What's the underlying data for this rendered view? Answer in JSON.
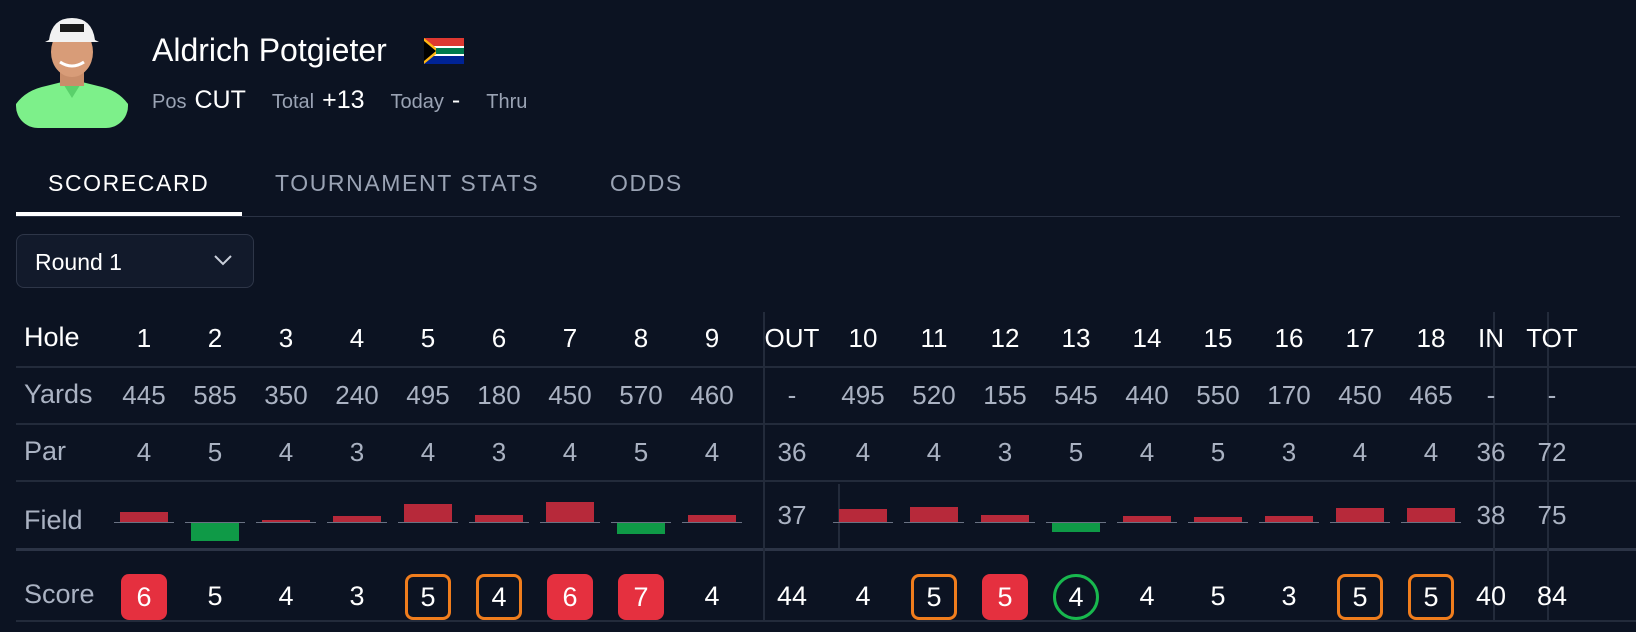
{
  "player": {
    "name": "Aldrich Potgieter",
    "flag": "south-africa-flag",
    "pos_label": "Pos",
    "pos": "CUT",
    "total_label": "Total",
    "total": "+13",
    "today_label": "Today",
    "today": "-",
    "thru_label": "Thru",
    "thru": ""
  },
  "tabs": [
    {
      "label": "SCORECARD",
      "active": true
    },
    {
      "label": "TOURNAMENT STATS",
      "active": false
    },
    {
      "label": "ODDS",
      "active": false
    }
  ],
  "round_select": {
    "value": "Round 1",
    "icon": "chevron-down-icon"
  },
  "scorecard": {
    "row_labels": {
      "hole": "Hole",
      "yards": "Yards",
      "par": "Par",
      "field": "Field",
      "score": "Score"
    },
    "columns": [
      "1",
      "2",
      "3",
      "4",
      "5",
      "6",
      "7",
      "8",
      "9",
      "OUT",
      "10",
      "11",
      "12",
      "13",
      "14",
      "15",
      "16",
      "17",
      "18",
      "IN",
      "TOT"
    ],
    "yards": [
      "445",
      "585",
      "350",
      "240",
      "495",
      "180",
      "450",
      "570",
      "460",
      "-",
      "495",
      "520",
      "155",
      "545",
      "440",
      "550",
      "170",
      "450",
      "465",
      "-",
      "-"
    ],
    "par": [
      "4",
      "5",
      "4",
      "3",
      "4",
      "3",
      "4",
      "5",
      "4",
      "36",
      "4",
      "4",
      "3",
      "5",
      "4",
      "5",
      "3",
      "4",
      "4",
      "36",
      "72"
    ],
    "field_totals": {
      "out": "37",
      "in": "38",
      "tot": "75"
    },
    "field_vs_par": [
      0.12,
      -0.22,
      0.03,
      0.08,
      0.22,
      0.09,
      0.25,
      -0.14,
      0.09,
      null,
      0.16,
      0.19,
      0.09,
      -0.11,
      0.08,
      0.06,
      0.08,
      0.18,
      0.18
    ],
    "score": [
      {
        "v": "6",
        "type": "double"
      },
      {
        "v": "5",
        "type": "par"
      },
      {
        "v": "4",
        "type": "par"
      },
      {
        "v": "3",
        "type": "par"
      },
      {
        "v": "5",
        "type": "bogey"
      },
      {
        "v": "4",
        "type": "bogey"
      },
      {
        "v": "6",
        "type": "double"
      },
      {
        "v": "7",
        "type": "double"
      },
      {
        "v": "4",
        "type": "par"
      },
      {
        "v": "44",
        "type": "total"
      },
      {
        "v": "4",
        "type": "par"
      },
      {
        "v": "5",
        "type": "bogey"
      },
      {
        "v": "5",
        "type": "double"
      },
      {
        "v": "4",
        "type": "birdie"
      },
      {
        "v": "4",
        "type": "par"
      },
      {
        "v": "5",
        "type": "par"
      },
      {
        "v": "3",
        "type": "par"
      },
      {
        "v": "5",
        "type": "bogey"
      },
      {
        "v": "5",
        "type": "bogey"
      },
      {
        "v": "40",
        "type": "total"
      },
      {
        "v": "84",
        "type": "total"
      }
    ],
    "colors": {
      "over": "#b7293a",
      "under": "#0f9a47",
      "double": "#e5303f",
      "bogey": "#f07d1d",
      "birdie": "#18b84e"
    }
  }
}
